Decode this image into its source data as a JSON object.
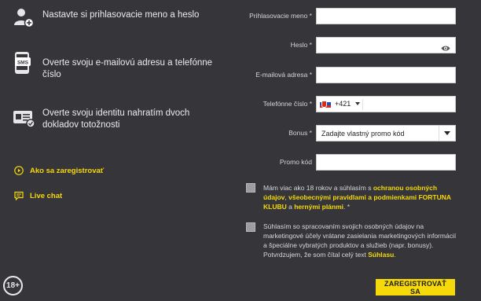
{
  "steps": [
    {
      "text": "Nastavte si prihlasovacie meno a heslo",
      "icon": "user-add-icon"
    },
    {
      "text": "Overte svoju e-mailovú adresu a telefónne číslo",
      "icon": "sms-phone-icon"
    },
    {
      "text": "Overte svoju identitu nahratím dvoch dokladov totožnosti",
      "icon": "id-card-icon"
    }
  ],
  "links": {
    "how_to_register": "Ako sa zaregistrovať",
    "live_chat": "Live chat"
  },
  "age_badge": "18+",
  "form": {
    "username_label": "Prihlasovacie meno *",
    "password_label": "Heslo *",
    "email_label": "E-mailová adresa *",
    "phone_label": "Telefónne číslo *",
    "phone_prefix": "+421",
    "bonus_label": "Bonus *",
    "bonus_value": "Zadajte vlastný promo kód",
    "promo_label": "Promo kód"
  },
  "consents": {
    "c1_a": "Mám viac ako 18 rokov a súhlasím s ",
    "c1_link1": "ochranou osobných údajov",
    "c1_b": ", ",
    "c1_link2": "všeobecnými pravidlami a podmienkami FORTUNA KLUBU",
    "c1_c": " a ",
    "c1_link3": "hernými plánmi",
    "c1_d": ". *",
    "c2_a": "Súhlasím so spracovaním svojich osobných údajov na marketingové účely vrátane zasielania marketingových informácií a špeciálne vybratých produktov a služieb (napr. bonusy). Potvrdzujem, že som čítal celý text ",
    "c2_link": "Súhlasu",
    "c2_b": "."
  },
  "submit_label": "ZAREGISTROVAŤ SA",
  "colors": {
    "background": "#35353a",
    "accent": "#f5d90a"
  }
}
